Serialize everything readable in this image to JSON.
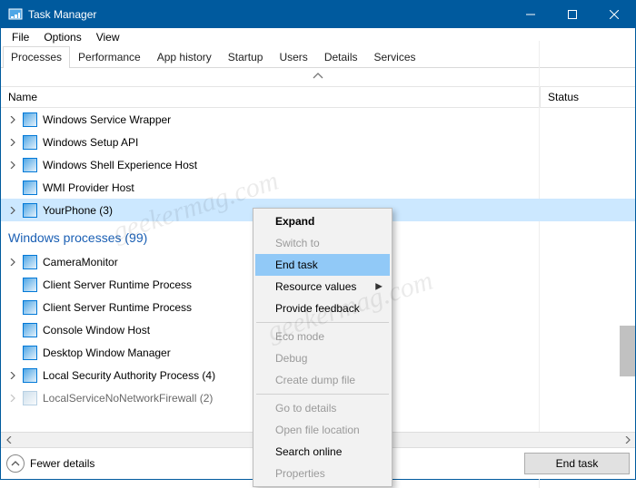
{
  "window": {
    "title": "Task Manager"
  },
  "menubar": {
    "items": [
      "File",
      "Options",
      "View"
    ]
  },
  "tabs": {
    "items": [
      "Processes",
      "Performance",
      "App history",
      "Startup",
      "Users",
      "Details",
      "Services"
    ],
    "active_index": 0
  },
  "columns": {
    "name": "Name",
    "status": "Status"
  },
  "rows": [
    {
      "label": "Windows Service Wrapper",
      "expandable": true,
      "selected": false
    },
    {
      "label": "Windows Setup API",
      "expandable": true,
      "selected": false
    },
    {
      "label": "Windows Shell Experience Host",
      "expandable": true,
      "selected": false
    },
    {
      "label": "WMI Provider Host",
      "expandable": false,
      "selected": false
    },
    {
      "label": "YourPhone (3)",
      "expandable": true,
      "selected": true
    }
  ],
  "group": {
    "header": "Windows processes (99)"
  },
  "rows2": [
    {
      "label": "CameraMonitor",
      "expandable": true,
      "dim": false
    },
    {
      "label": "Client Server Runtime Process",
      "expandable": false,
      "dim": false
    },
    {
      "label": "Client Server Runtime Process",
      "expandable": false,
      "dim": false
    },
    {
      "label": "Console Window Host",
      "expandable": false,
      "dim": false
    },
    {
      "label": "Desktop Window Manager",
      "expandable": false,
      "dim": false
    },
    {
      "label": "Local Security Authority Process (4)",
      "expandable": true,
      "dim": false
    },
    {
      "label": "LocalServiceNoNetworkFirewall (2)",
      "expandable": true,
      "dim": true
    }
  ],
  "context_menu": {
    "items": [
      {
        "label": "Expand",
        "bold": true
      },
      {
        "label": "Switch to",
        "disabled": true
      },
      {
        "label": "End task",
        "highlight": true
      },
      {
        "label": "Resource values",
        "submenu": true
      },
      {
        "label": "Provide feedback"
      },
      {
        "sep": true
      },
      {
        "label": "Eco mode",
        "disabled": true
      },
      {
        "label": "Debug",
        "disabled": true
      },
      {
        "label": "Create dump file",
        "disabled": true
      },
      {
        "sep": true
      },
      {
        "label": "Go to details",
        "disabled": true
      },
      {
        "label": "Open file location",
        "disabled": true
      },
      {
        "label": "Search online"
      },
      {
        "label": "Properties",
        "disabled": true
      }
    ]
  },
  "footer": {
    "fewer": "Fewer details",
    "end_task": "End task"
  },
  "watermark": "geekermag.com"
}
